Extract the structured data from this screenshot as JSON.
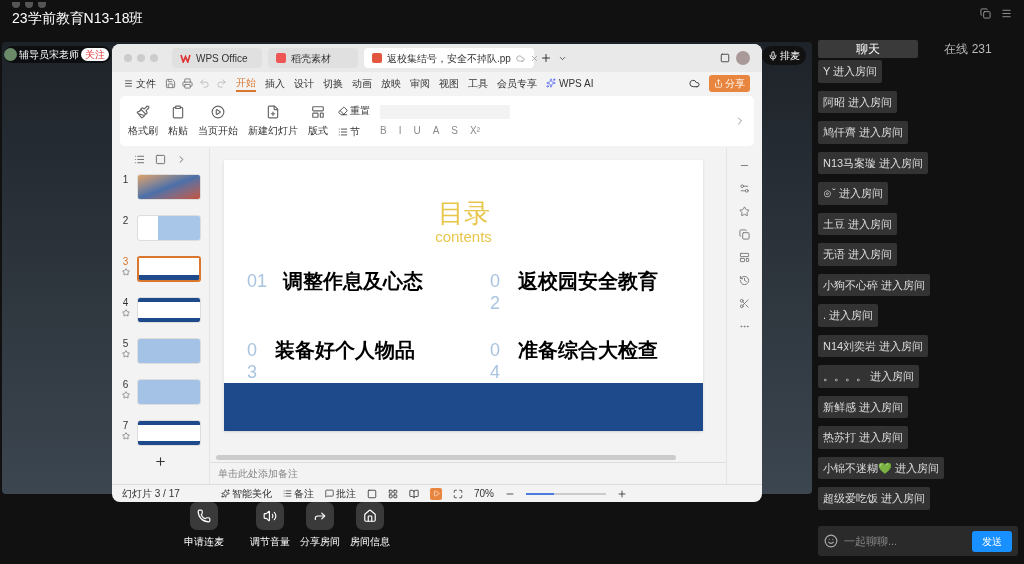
{
  "window": {
    "title": "23学前教育N13-18班"
  },
  "presenter": {
    "name": "辅导员宋老师",
    "follow": "关注"
  },
  "queue_button": "排麦",
  "wps": {
    "tabs": [
      {
        "label": "WPS Office",
        "kind": "wps",
        "selected": false
      },
      {
        "label": "稻壳素材",
        "kind": "docer",
        "selected": false
      },
      {
        "label": "返校集结号，安全不掉队.pp",
        "kind": "ppt",
        "selected": true
      }
    ],
    "file_menu": "文件",
    "ribbon_tabs": [
      {
        "label": "开始",
        "selected": true
      },
      {
        "label": "插入",
        "selected": false
      },
      {
        "label": "设计",
        "selected": false
      },
      {
        "label": "切换",
        "selected": false
      },
      {
        "label": "动画",
        "selected": false
      },
      {
        "label": "放映",
        "selected": false
      },
      {
        "label": "审阅",
        "selected": false
      },
      {
        "label": "视图",
        "selected": false
      },
      {
        "label": "工具",
        "selected": false
      },
      {
        "label": "会员专享",
        "selected": false
      }
    ],
    "ai": "WPS AI",
    "share": "分享",
    "tools": [
      {
        "label": "格式刷",
        "kind": "brush"
      },
      {
        "label": "粘贴",
        "kind": "paste"
      },
      {
        "label": "当页开始",
        "kind": "play"
      },
      {
        "label": "新建幻灯片",
        "kind": "new"
      },
      {
        "label": "版式",
        "kind": "layout"
      }
    ],
    "reset": "重置",
    "section": "节",
    "format_buttons": [
      {
        "label": "B",
        "disabled": true
      },
      {
        "label": "I",
        "disabled": true
      },
      {
        "label": "U",
        "disabled": true
      },
      {
        "label": "A",
        "disabled": true
      },
      {
        "label": "S",
        "disabled": true
      },
      {
        "label": "X²",
        "disabled": true
      }
    ],
    "thumbnails": [
      {
        "number": "1",
        "kind": "photo",
        "selected": false
      },
      {
        "number": "2",
        "kind": "light",
        "selected": false
      },
      {
        "number": "3",
        "kind": "toc",
        "selected": true
      },
      {
        "number": "4",
        "kind": "title",
        "selected": false
      },
      {
        "number": "5",
        "kind": "wave",
        "selected": false
      },
      {
        "number": "6",
        "kind": "wave",
        "selected": false
      },
      {
        "number": "7",
        "kind": "title",
        "selected": false
      }
    ],
    "slide": {
      "title": "目录",
      "subtitle": "contents",
      "items": [
        {
          "number": "01",
          "text": "调整作息及心态",
          "wrapped": false
        },
        {
          "number": "02",
          "text": "返校园安全教育",
          "wrapped": true
        },
        {
          "number": "03",
          "text": "装备好个人物品",
          "wrapped": true
        },
        {
          "number": "04",
          "text": "准备综合大检查",
          "wrapped": true
        }
      ]
    },
    "notes": {
      "placeholder": "单击此处添加备注"
    },
    "status_bar": {
      "slide": "幻灯片 3 / 17",
      "beautify": "智能美化",
      "notes": "备注",
      "comments": "批注",
      "zoom": "70%",
      "level": 0.35
    }
  },
  "controls": [
    {
      "label": "申请连麦",
      "kind": "call"
    },
    {
      "label": "调节音量",
      "kind": "volume"
    },
    {
      "label": "分享房间",
      "kind": "share"
    },
    {
      "label": "房间信息",
      "kind": "info"
    }
  ],
  "chat": {
    "tabs": [
      {
        "label": "聊天",
        "selected": true
      },
      {
        "label": "在线 231",
        "selected": false
      }
    ],
    "messages": [
      "Y 进入房间",
      "阿昭 进入房间",
      "鸠仟齊 进入房间",
      "N13马案璇 进入房间",
      "⊙ˇ 进入房间",
      "土豆 进入房间",
      "无语 进入房间",
      "小狗不心碎 进入房间",
      ". 进入房间",
      "N14刘奕岩 进入房间",
      "。。。。 进入房间",
      "新鲜感 进入房间",
      "热苏打 进入房间",
      "小锦不迷糊💚 进入房间",
      "超级爱吃饭 进入房间"
    ],
    "input": {
      "placeholder": "一起聊聊..."
    },
    "send": "发送"
  }
}
